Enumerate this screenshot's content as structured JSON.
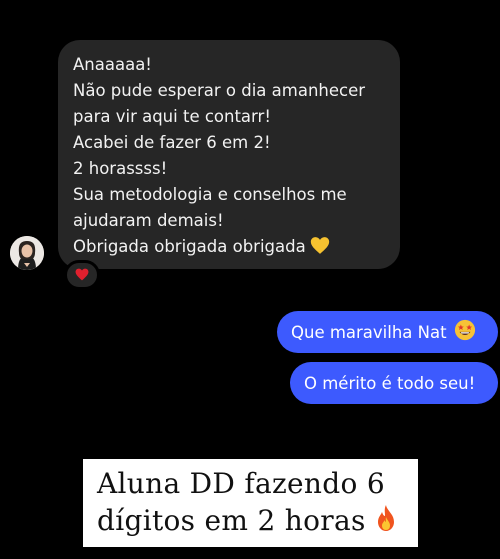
{
  "conversation": {
    "incoming": {
      "lines": [
        "Anaaaaa!",
        "Não pude esperar o dia amanhecer",
        "para vir aqui te contarr!",
        "Acabei de fazer 6 em 2!",
        "2 horassss!",
        "Sua metodologia e conselhos me",
        "ajudaram demais!",
        "Obrigada obrigada obrigada"
      ],
      "trailing_emoji": "yellow-heart-icon",
      "reaction": "red-heart-icon",
      "avatar": "avatar"
    },
    "outgoing": [
      {
        "text": "Que maravilha Nat",
        "emoji": "star-struck-face-icon"
      },
      {
        "text": "O mérito é todo seu!"
      }
    ]
  },
  "caption": {
    "line1": "Aluna DD fazendo 6",
    "line2": "dígitos em 2 horas",
    "emoji": "fire-icon"
  },
  "colors": {
    "background": "#000000",
    "incoming_bubble": "#262626",
    "outgoing_bubble": "#3d5afe",
    "caption_background": "#ffffff"
  }
}
